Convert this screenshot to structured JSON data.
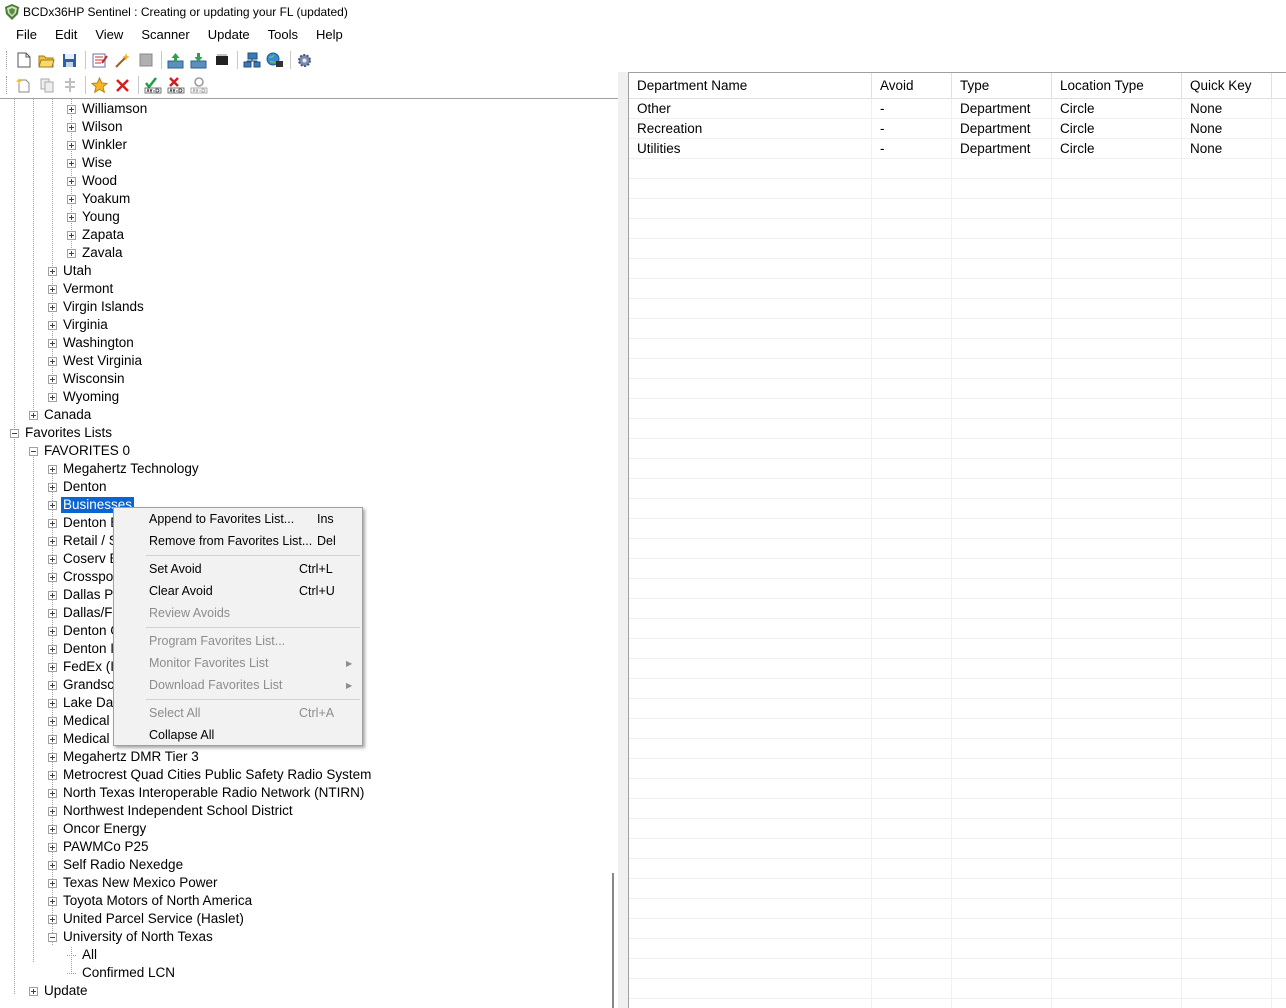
{
  "window": {
    "title": "BCDx36HP Sentinel : Creating or updating your FL (updated)"
  },
  "menubar": [
    "File",
    "Edit",
    "View",
    "Scanner",
    "Update",
    "Tools",
    "Help"
  ],
  "tree": {
    "items": [
      {
        "label": "Williamson",
        "type": "plus"
      },
      {
        "label": "Wilson",
        "type": "plus"
      },
      {
        "label": "Winkler",
        "type": "plus"
      },
      {
        "label": "Wise",
        "type": "plus"
      },
      {
        "label": "Wood",
        "type": "plus"
      },
      {
        "label": "Yoakum",
        "type": "plus"
      },
      {
        "label": "Young",
        "type": "plus"
      },
      {
        "label": "Zapata",
        "type": "plus"
      },
      {
        "label": "Zavala",
        "type": "plus"
      },
      {
        "label": "Utah",
        "type": "plus"
      },
      {
        "label": "Vermont",
        "type": "plus"
      },
      {
        "label": "Virgin Islands",
        "type": "plus"
      },
      {
        "label": "Virginia",
        "type": "plus"
      },
      {
        "label": "Washington",
        "type": "plus"
      },
      {
        "label": "West Virginia",
        "type": "plus"
      },
      {
        "label": "Wisconsin",
        "type": "plus"
      },
      {
        "label": "Wyoming",
        "type": "plus"
      },
      {
        "label": "Canada",
        "type": "plus"
      },
      {
        "label": "Favorites Lists",
        "type": "minus"
      },
      {
        "label": "FAVORITES 0",
        "type": "minus"
      },
      {
        "label": "Megahertz Technology",
        "type": "plus"
      },
      {
        "label": "Denton",
        "type": "plus"
      },
      {
        "label": "Businesses",
        "type": "plus",
        "selected": true
      },
      {
        "label": "Denton E",
        "type": "plus"
      },
      {
        "label": "Retail / S",
        "type": "plus"
      },
      {
        "label": "Coserv E",
        "type": "plus"
      },
      {
        "label": "Crosspo",
        "type": "plus"
      },
      {
        "label": "Dallas P",
        "type": "plus"
      },
      {
        "label": "Dallas/F",
        "type": "plus"
      },
      {
        "label": "Denton C",
        "type": "plus"
      },
      {
        "label": "Denton I",
        "type": "plus"
      },
      {
        "label": "FedEx (I",
        "type": "plus"
      },
      {
        "label": "Grandsc",
        "type": "plus"
      },
      {
        "label": "Lake Da",
        "type": "plus"
      },
      {
        "label": "Medical",
        "type": "plus"
      },
      {
        "label": "Medical",
        "type": "plus"
      },
      {
        "label": "Megahertz DMR Tier 3",
        "type": "plus"
      },
      {
        "label": "Metrocrest Quad Cities Public Safety Radio System",
        "type": "plus"
      },
      {
        "label": "North Texas Interoperable Radio Network (NTIRN)",
        "type": "plus"
      },
      {
        "label": "Northwest Independent School District",
        "type": "plus"
      },
      {
        "label": "Oncor Energy",
        "type": "plus"
      },
      {
        "label": "PAWMCo P25",
        "type": "plus"
      },
      {
        "label": "Self Radio Nexedge",
        "type": "plus"
      },
      {
        "label": "Texas New Mexico Power",
        "type": "plus"
      },
      {
        "label": "Toyota Motors of North America",
        "type": "plus"
      },
      {
        "label": "United Parcel Service (Haslet)",
        "type": "plus"
      },
      {
        "label": "University of North Texas",
        "type": "minus"
      },
      {
        "label": "All",
        "type": "leaf"
      },
      {
        "label": "Confirmed LCN",
        "type": "leaf"
      },
      {
        "label": "Update",
        "type": "plus"
      }
    ]
  },
  "grid": {
    "columns": [
      "Department Name",
      "Avoid",
      "Type",
      "Location Type",
      "Quick Key"
    ],
    "rows": [
      [
        "Other",
        "-",
        "Department",
        "Circle",
        "None"
      ],
      [
        "Recreation",
        "-",
        "Department",
        "Circle",
        "None"
      ],
      [
        "Utilities",
        "-",
        "Department",
        "Circle",
        "None"
      ]
    ]
  },
  "context_menu": {
    "items": [
      {
        "label": "Append to Favorites List...",
        "key": "Ins",
        "enabled": true
      },
      {
        "label": "Remove from Favorites List...",
        "key": "Del",
        "enabled": true
      },
      {
        "sep": true
      },
      {
        "label": "Set Avoid",
        "key": "Ctrl+L",
        "enabled": true
      },
      {
        "label": "Clear Avoid",
        "key": "Ctrl+U",
        "enabled": true
      },
      {
        "label": "Review Avoids",
        "key": "",
        "enabled": false
      },
      {
        "sep": true
      },
      {
        "label": "Program Favorites List...",
        "key": "",
        "enabled": false
      },
      {
        "label": "Monitor Favorites List",
        "key": "",
        "enabled": false,
        "submenu": true
      },
      {
        "label": "Download Favorites List",
        "key": "",
        "enabled": false,
        "submenu": true
      },
      {
        "sep": true
      },
      {
        "label": "Select All",
        "key": "Ctrl+A",
        "enabled": false
      },
      {
        "label": "Collapse All",
        "key": "",
        "enabled": true
      }
    ]
  },
  "icons": {
    "toolbar1": [
      "new-file-icon",
      "open-folder-icon",
      "save-icon",
      "edit-icon",
      "wizard-icon",
      "stop-icon",
      "upload-icon",
      "download-icon",
      "sd-card-icon",
      "network-icon",
      "globe-icon",
      "settings-icon"
    ],
    "toolbar2": [
      "new-item-icon",
      "copy-icon",
      "split-icon",
      "favorite-star-icon",
      "delete-icon",
      "set-avoid-icon",
      "clear-avoid-icon",
      "review-avoid-icon"
    ]
  }
}
